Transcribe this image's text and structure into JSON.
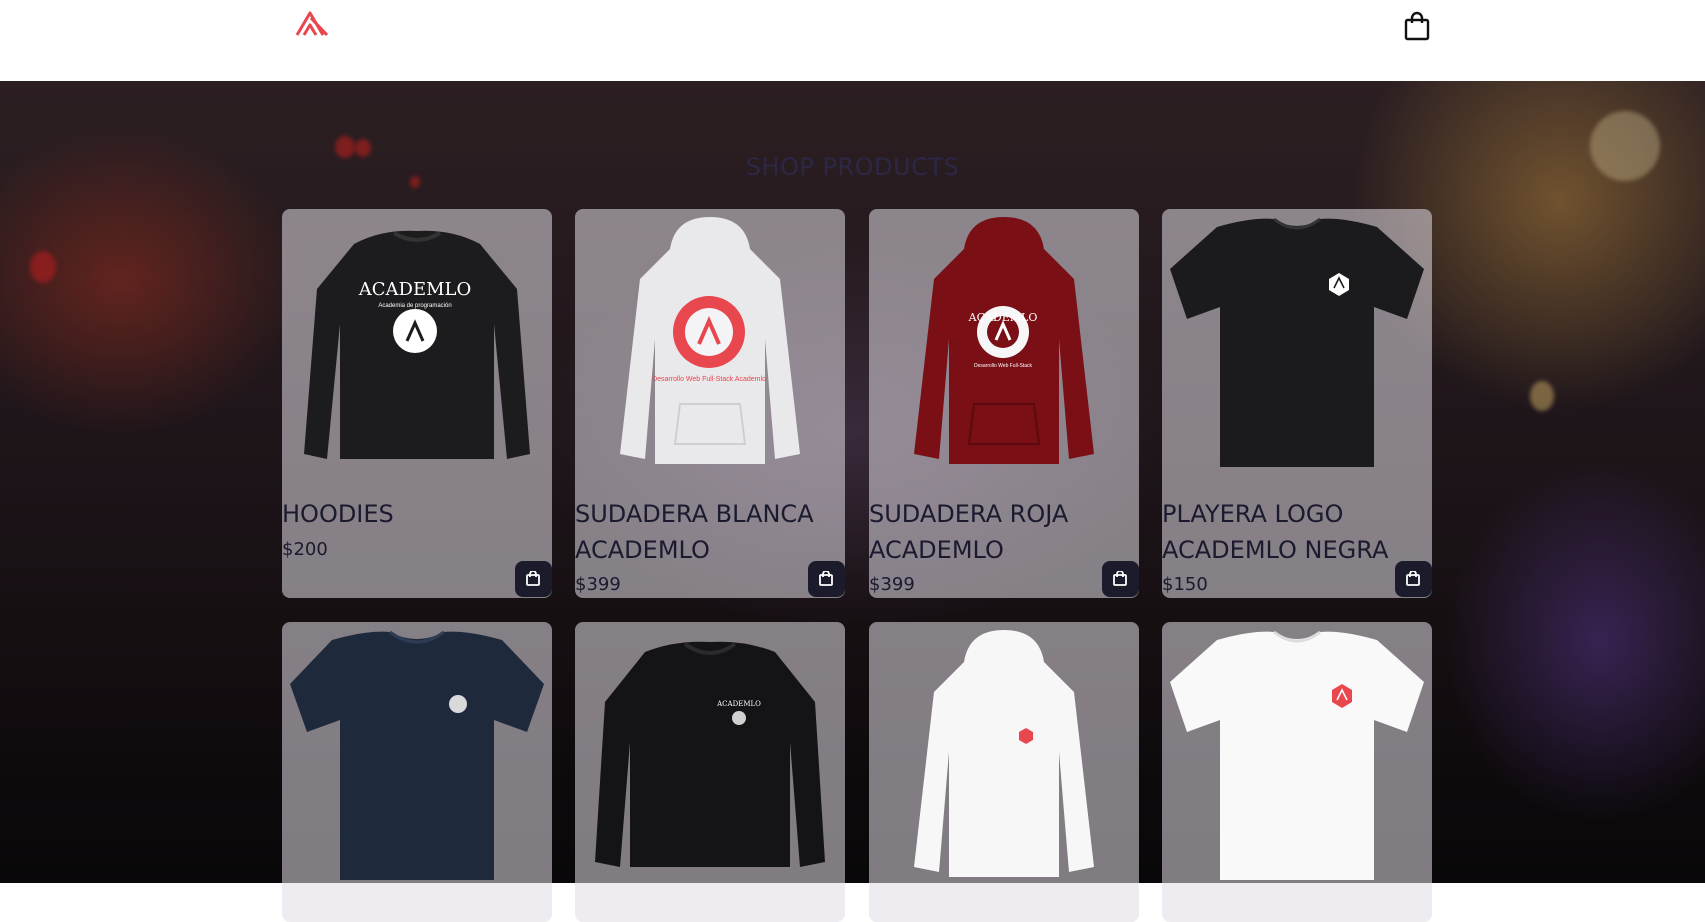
{
  "section": {
    "title": "SHOP PRODUCTS"
  },
  "products": [
    {
      "name": "HOODIES",
      "price": "$200"
    },
    {
      "name": "SUDADERA BLANCA ACADEMLO",
      "price": "$399"
    },
    {
      "name": "SUDADERA ROJA ACADEMLO",
      "price": "$399"
    },
    {
      "name": "PLAYERA LOGO ACADEMLO NEGRA",
      "price": "$150"
    }
  ],
  "product_art": {
    "hoodies": {
      "line1": "ACADEMLO",
      "line2": "Academia de programación"
    },
    "white_hoodie": {
      "text": "Desarrollo Web Full-Stack Academlo"
    },
    "red_hoodie": {
      "line1": "ACADEMLO",
      "line2": "Desarrollo Web Full-Stack"
    },
    "black_sweater": {
      "text": "ACADEMLO"
    }
  },
  "icons": {
    "logo": "academlo-logo-icon",
    "cart": "shopping-bag-icon",
    "add": "add-to-cart-icon"
  },
  "colors": {
    "brand": "#e8474e",
    "button": "#1b1b2b",
    "text": "#1b1a2e"
  }
}
